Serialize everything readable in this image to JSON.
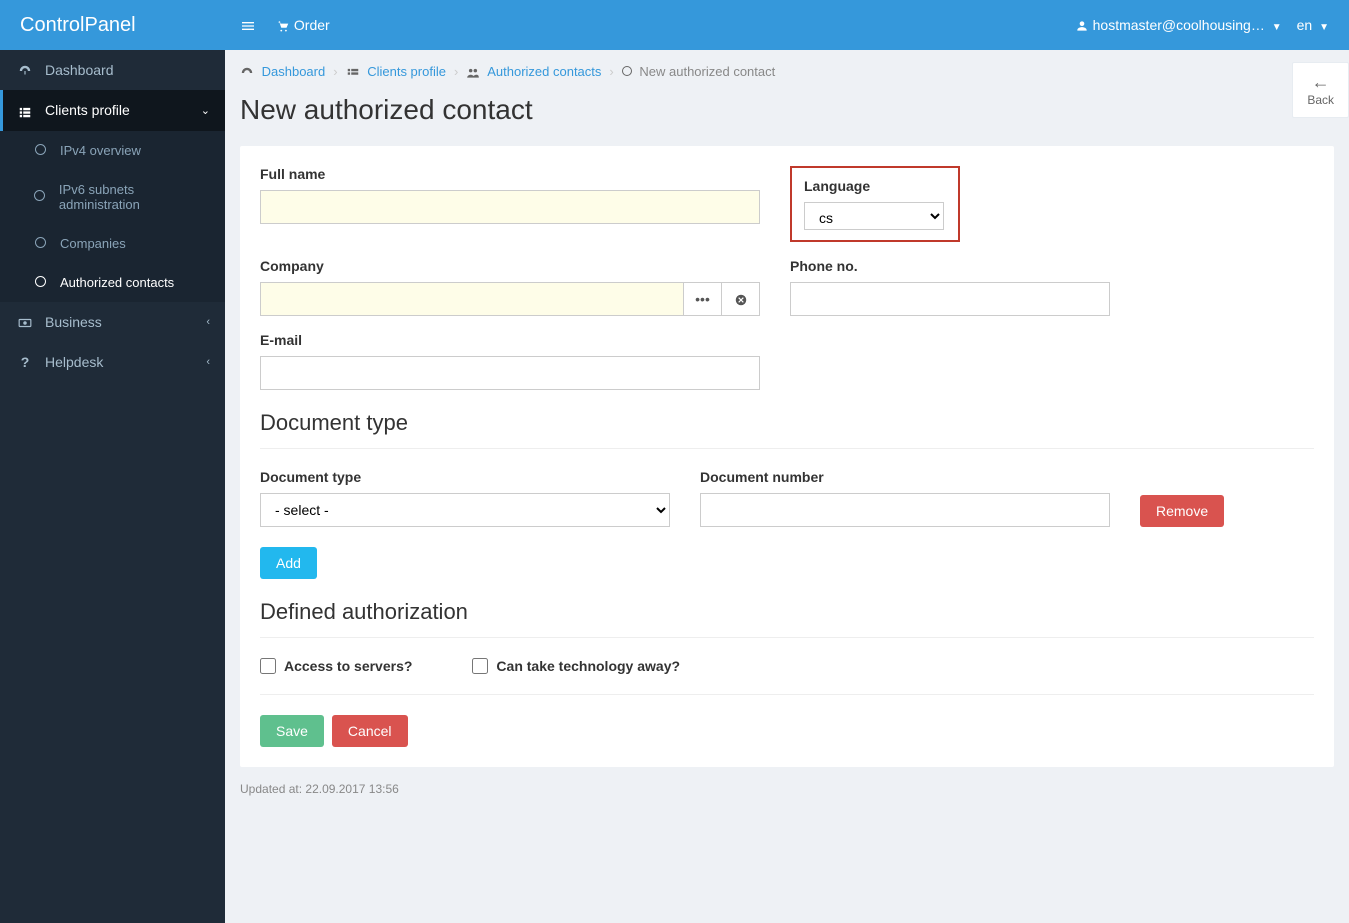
{
  "brand": "ControlPanel",
  "topbar": {
    "order_label": "Order",
    "user_label": "hostmaster@coolhousing…",
    "lang_label": "en"
  },
  "sidebar": {
    "dashboard": "Dashboard",
    "clients_profile": "Clients profile",
    "ipv4": "IPv4 overview",
    "ipv6": "IPv6 subnets administration",
    "companies": "Companies",
    "auth_contacts": "Authorized contacts",
    "business": "Business",
    "helpdesk": "Helpdesk"
  },
  "breadcrumbs": {
    "dashboard": "Dashboard",
    "clients_profile": "Clients profile",
    "auth_contacts": "Authorized contacts",
    "current": "New authorized contact"
  },
  "page_title": "New authorized contact",
  "back_label": "Back",
  "form": {
    "full_name_label": "Full name",
    "company_label": "Company",
    "email_label": "E-mail",
    "language_label": "Language",
    "language_value": "cs",
    "phone_label": "Phone no."
  },
  "doc": {
    "section_title": "Document type",
    "type_label": "Document type",
    "type_placeholder": "- select -",
    "number_label": "Document number",
    "remove_label": "Remove",
    "add_label": "Add"
  },
  "auth": {
    "section_title": "Defined authorization",
    "access_servers": "Access to servers?",
    "take_tech": "Can take technology away?"
  },
  "actions": {
    "save": "Save",
    "cancel": "Cancel"
  },
  "footer": {
    "updated_label": "Updated at:",
    "updated_value": "22.09.2017 13:56"
  }
}
